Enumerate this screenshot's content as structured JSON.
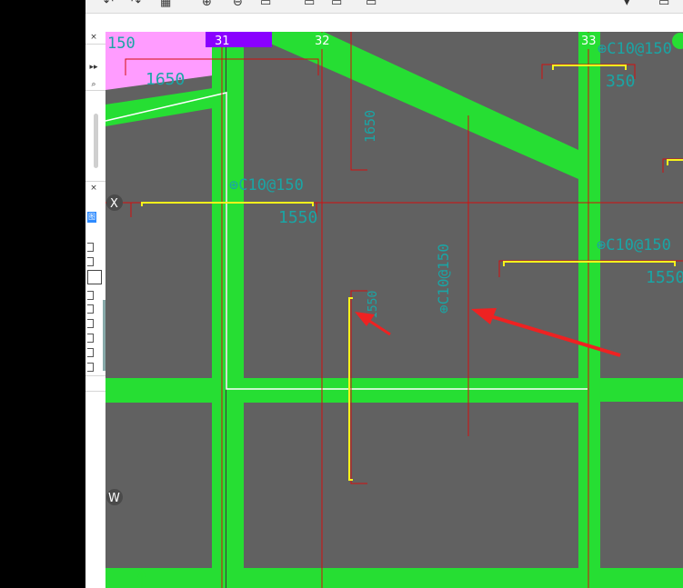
{
  "app": {
    "accent_green": "#26de33",
    "canvas_bg": "#616161",
    "red_line": "#d40e0e",
    "yellow_line": "#f7f21b",
    "teal_text": "#1aa5a5",
    "purple_tag": "#8a00ff",
    "pink_zone": "#ff9cff"
  },
  "toolbar": {
    "icons": [
      "undo-icon",
      "redo-icon",
      "grid-icon",
      "zoom-in-icon",
      "zoom-out-icon",
      "save-icon",
      "layer-icon",
      "copy-icon",
      "open-icon",
      "minimize-icon",
      "maximize-icon"
    ]
  },
  "left_panel": {
    "close_top": "×",
    "expand": "▸▸",
    "search": "⌕",
    "close_mid": "×",
    "blue_button": "图"
  },
  "drawing": {
    "grid_labels": {
      "col_31": "31",
      "col_32": "32",
      "col_33": "33",
      "row_x": "X",
      "row_w": "W"
    },
    "dimensions": {
      "top_left_150": "150",
      "top_left_1650": "1650",
      "left_1550": "1550",
      "right_1550": "1550",
      "top_right_350": "350"
    },
    "rebar_labels": {
      "left_beam": "⊕C10@150",
      "right_beam": "⊕C10@150",
      "top_right": "⊕C10@150",
      "vertical_mid": "⊕C10@150",
      "vertical_top": "1650",
      "vertical_small": "1550"
    }
  }
}
